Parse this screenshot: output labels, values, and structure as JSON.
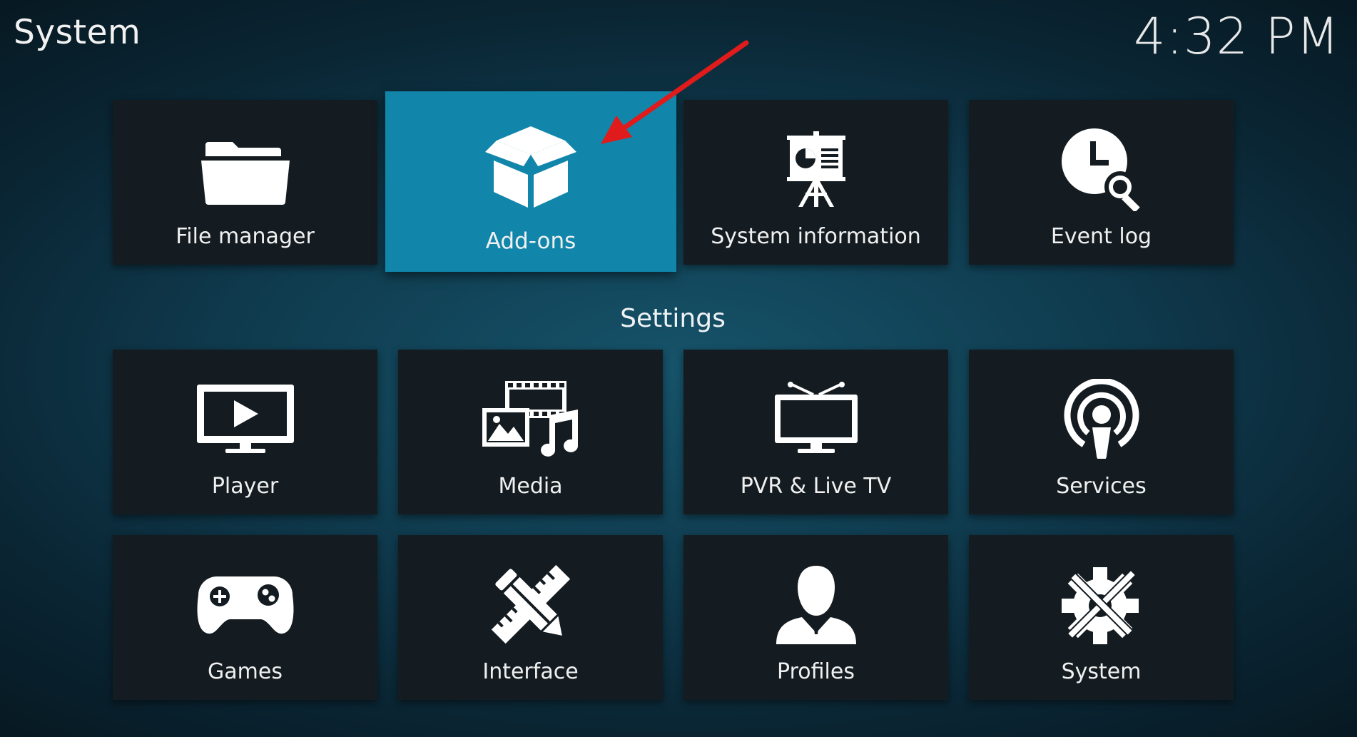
{
  "header": {
    "title": "System",
    "time": "4:32 PM"
  },
  "top_row": [
    {
      "label": "File manager",
      "icon": "folder-icon"
    },
    {
      "label": "Add-ons",
      "icon": "box-icon",
      "focused": true
    },
    {
      "label": "System information",
      "icon": "presentation-icon"
    },
    {
      "label": "Event log",
      "icon": "clock-search-icon"
    }
  ],
  "settings": {
    "heading": "Settings",
    "items": [
      {
        "label": "Player",
        "icon": "tv-play-icon"
      },
      {
        "label": "Media",
        "icon": "media-icon"
      },
      {
        "label": "PVR & Live TV",
        "icon": "tv-antenna-icon"
      },
      {
        "label": "Services",
        "icon": "broadcast-icon"
      },
      {
        "label": "Games",
        "icon": "gamepad-icon"
      },
      {
        "label": "Interface",
        "icon": "pencil-ruler-icon"
      },
      {
        "label": "Profiles",
        "icon": "user-icon"
      },
      {
        "label": "System",
        "icon": "gear-wrench-icon"
      }
    ]
  },
  "colors": {
    "focus": "#1186aa",
    "tile": "#141c21",
    "annotation_arrow": "#e01b1b"
  }
}
